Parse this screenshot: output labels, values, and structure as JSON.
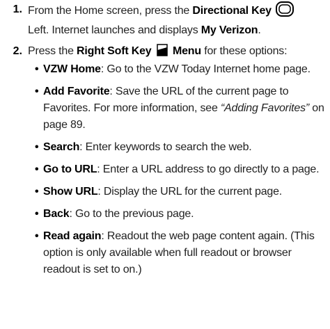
{
  "steps": [
    {
      "number": "1.",
      "line1_pre": "From the Home screen, press the ",
      "line1_bold": "Directional Key",
      "line2_pre": "Left. Internet launches and displays ",
      "line2_bold": "My Verizon",
      "line2_post": ".",
      "icon": "directional-key-icon"
    },
    {
      "number": "2.",
      "pre": "Press the ",
      "bold1": "Right Soft Key",
      "bold2": "Menu",
      "post": " for these options:",
      "icon": "right-soft-key-icon"
    }
  ],
  "options": [
    {
      "name": "VZW Home",
      "desc": ": Go to the VZW Today Internet home page."
    },
    {
      "name": "Add Favorite",
      "desc": ": Save the URL of the current page to Favorites. For more information, see ",
      "link": "“Adding Favorites”",
      "link_post": " on page 89."
    },
    {
      "name": "Search",
      "desc": ": Enter keywords to search the web."
    },
    {
      "name": "Go to URL",
      "desc": ": Enter a URL address to go directly to a page."
    },
    {
      "name": "Show URL",
      "desc": ": Display the URL for the current page."
    },
    {
      "name": "Back",
      "desc": ": Go to the previous page."
    },
    {
      "name": "Read again",
      "desc": ": Readout the web page content again. (This option is only available when full readout or browser readout is set to on.)"
    }
  ],
  "bullet_char": "•"
}
